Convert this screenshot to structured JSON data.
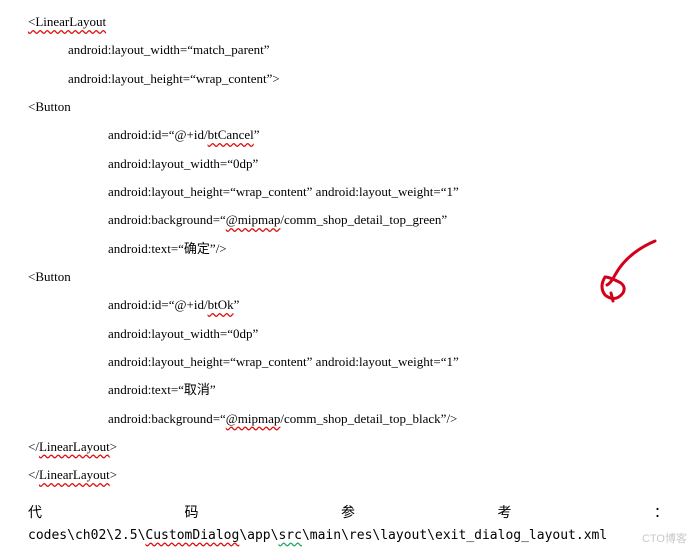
{
  "code": {
    "l1": "<LinearLayout",
    "l2": "android:layout_width=“match_parent”",
    "l3": "android:layout_height=“wrap_content”>",
    "l4": "<Button",
    "l5a": "android:id=“@+id/",
    "l5b": "btCancel",
    "l5c": "”",
    "l6": "android:layout_width=“0dp”",
    "l7": "android:layout_height=“wrap_content” android:layout_weight=“1”",
    "l8a": "android:background=“",
    "l8b": "@mipmap",
    "l8c": "/comm_shop_detail_top_green”",
    "l9": "android:text=“确定”/>",
    "l10": "<Button",
    "l11a": "android:id=“@+id/",
    "l11b": "btOk",
    "l11c": "”",
    "l12": "android:layout_width=“0dp”",
    "l13": "android:layout_height=“wrap_content” android:layout_weight=“1”",
    "l14": "android:text=“取消”",
    "l15a": "android:background=“",
    "l15b": "@mipmap",
    "l15c": "/comm_shop_detail_top_black”/>",
    "l16a": "</",
    "l16b": "LinearLayout",
    "l16c": ">",
    "l17a": "</",
    "l17b": "LinearLayout",
    "l17c": ">"
  },
  "footer": {
    "c1": "代",
    "c2": "码",
    "c3": "参",
    "c4": "考",
    "c5": "：",
    "path_a": "codes\\ch02\\2.5\\",
    "path_b": "CustomDialog",
    "path_c": "\\app\\",
    "path_d": "src",
    "path_e": "\\main\\res\\layout\\exit_dialog_layout.xml"
  },
  "watermark": "CTO博客"
}
